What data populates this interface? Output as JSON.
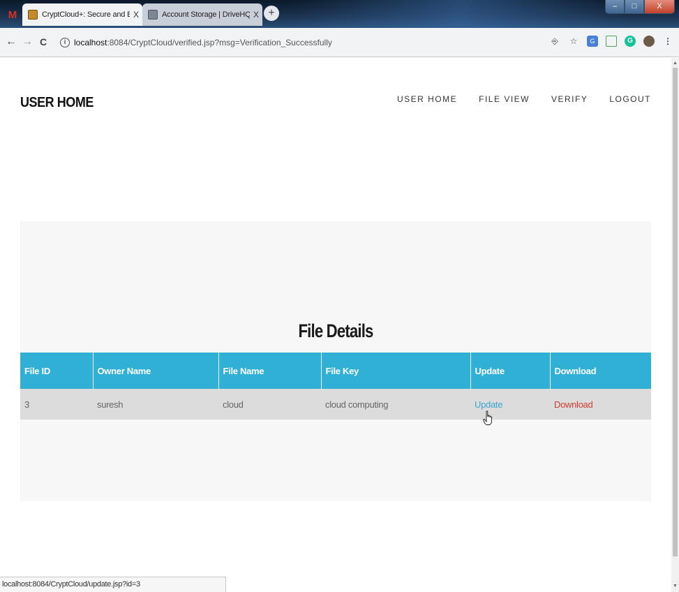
{
  "browser": {
    "tabs": [
      {
        "title": "CryptCloud+: Secure and Expres",
        "close": "X"
      },
      {
        "title": "Account Storage | DriveHQ",
        "close": "X"
      }
    ],
    "gmail_letter": "M",
    "new_tab": "+",
    "window_controls": {
      "minimize": "–",
      "maximize": "□",
      "close": "X"
    },
    "url_host": "localhost",
    "url_rest": ":8084/CryptCloud/verified.jsp?msg=Verification_Successfully",
    "nav": {
      "back": "←",
      "forward": "→",
      "reload": "C"
    },
    "status_url": "localhost:8084/CryptCloud/update.jsp?id=3"
  },
  "header": {
    "brand": "USER HOME",
    "menu": [
      "USER HOME",
      "FILE VIEW",
      "VERIFY",
      "LOGOUT"
    ]
  },
  "panel": {
    "title": "File Details",
    "columns": [
      "File ID",
      "Owner Name",
      "File Name",
      "File Key",
      "Update",
      "Download"
    ],
    "rows": [
      {
        "file_id": "3",
        "owner": "suresh",
        "file_name": "cloud",
        "file_key": "cloud computing",
        "update": "Update",
        "download": "Download"
      }
    ]
  },
  "colors": {
    "table_header": "#31b0d5",
    "update_link": "#3aa6d0",
    "download_link": "#d23b2c"
  }
}
